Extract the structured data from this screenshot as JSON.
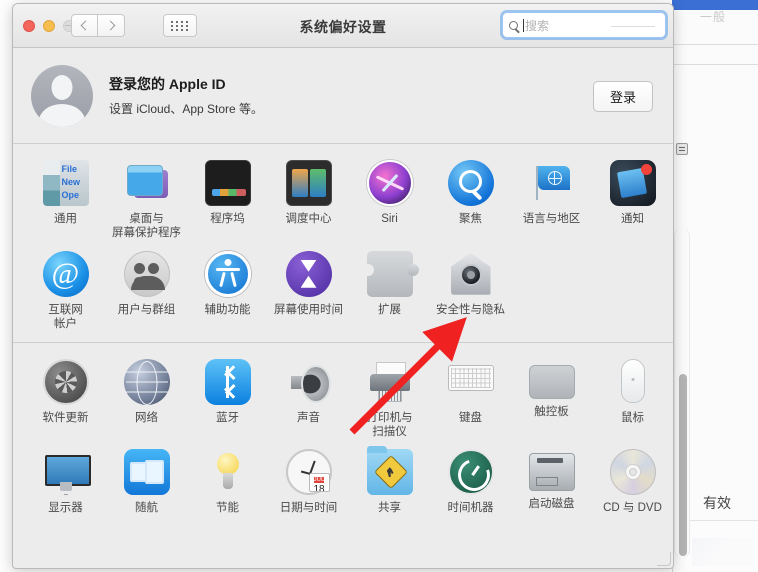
{
  "window": {
    "title": "系统偏好设置",
    "traffic_lights": [
      "close",
      "minimize",
      "zoom-disabled"
    ],
    "nav": {
      "back": "back-chevron",
      "forward": "forward-chevron",
      "show_all": "show-all-grid"
    },
    "search": {
      "placeholder": "搜索",
      "value": "",
      "icon": "search-icon",
      "focused": true
    }
  },
  "apple_id": {
    "title": "登录您的 Apple ID",
    "subtitle": "设置 iCloud、App Store 等。",
    "button": "登录",
    "avatar": "default-user-avatar"
  },
  "sections": [
    {
      "name": "personal",
      "rows": [
        [
          {
            "label": "通用",
            "icon": "general-icon"
          },
          {
            "label": "桌面与\n屏幕保护程序",
            "icon": "desktop-screensaver-icon"
          },
          {
            "label": "程序坞",
            "icon": "dock-icon"
          },
          {
            "label": "调度中心",
            "icon": "mission-control-icon"
          },
          {
            "label": "Siri",
            "icon": "siri-icon"
          },
          {
            "label": "聚焦",
            "icon": "spotlight-icon"
          },
          {
            "label": "语言与地区",
            "icon": "language-region-icon"
          },
          {
            "label": "通知",
            "icon": "notifications-icon"
          }
        ],
        [
          {
            "label": "互联网\n帐户",
            "icon": "internet-accounts-icon"
          },
          {
            "label": "用户与群组",
            "icon": "users-groups-icon"
          },
          {
            "label": "辅助功能",
            "icon": "accessibility-icon"
          },
          {
            "label": "屏幕使用时间",
            "icon": "screen-time-icon"
          },
          {
            "label": "扩展",
            "icon": "extensions-icon"
          },
          {
            "label": "安全性与隐私",
            "icon": "security-privacy-icon"
          }
        ]
      ]
    },
    {
      "name": "hardware",
      "rows": [
        [
          {
            "label": "软件更新",
            "icon": "software-update-icon"
          },
          {
            "label": "网络",
            "icon": "network-icon"
          },
          {
            "label": "蓝牙",
            "icon": "bluetooth-icon"
          },
          {
            "label": "声音",
            "icon": "sound-icon"
          },
          {
            "label": "打印机与\n扫描仪",
            "icon": "printers-scanners-icon"
          },
          {
            "label": "键盘",
            "icon": "keyboard-icon"
          },
          {
            "label": "触控板",
            "icon": "trackpad-icon"
          },
          {
            "label": "鼠标",
            "icon": "mouse-icon"
          }
        ],
        [
          {
            "label": "显示器",
            "icon": "displays-icon"
          },
          {
            "label": "随航",
            "icon": "sidecar-icon"
          },
          {
            "label": "节能",
            "icon": "energy-saver-icon"
          },
          {
            "label": "日期与时间",
            "icon": "date-time-icon",
            "badge_month": "JUL",
            "badge_day": "18"
          },
          {
            "label": "共享",
            "icon": "sharing-icon"
          },
          {
            "label": "时间机器",
            "icon": "time-machine-icon"
          },
          {
            "label": "启动磁盘",
            "icon": "startup-disk-icon"
          },
          {
            "label": "CD 与 DVD",
            "icon": "cd-dvd-icon"
          }
        ]
      ]
    }
  ],
  "annotation": {
    "type": "arrow",
    "color": "#ef2121",
    "points_at": "安全性与隐私"
  },
  "background_window": {
    "status_text": "有效",
    "faint_text": "一般"
  }
}
